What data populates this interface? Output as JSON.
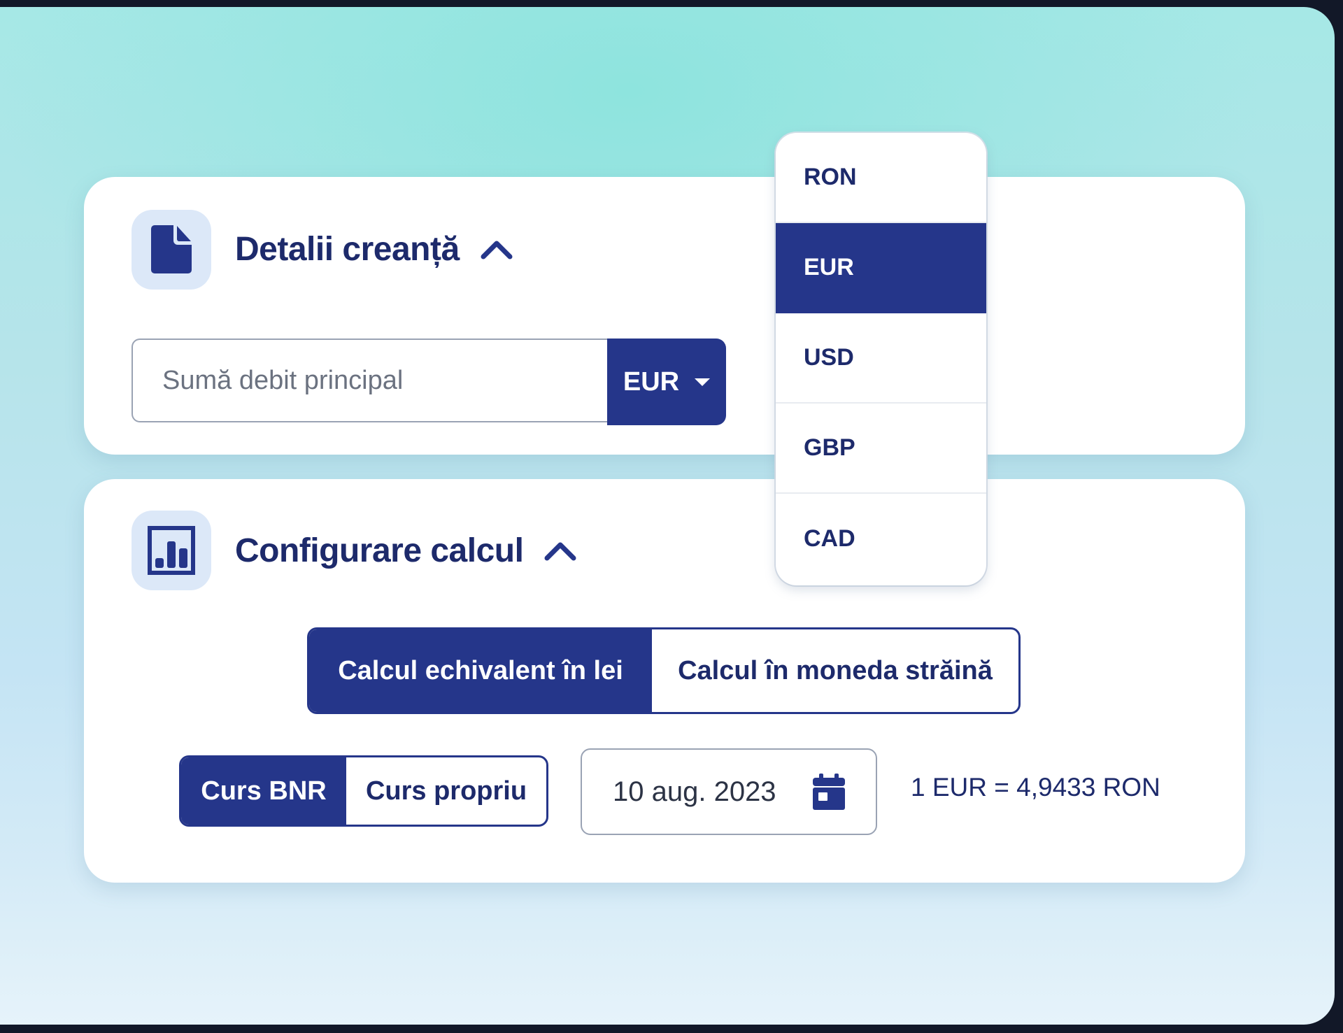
{
  "section_debt": {
    "title": "Detalii creanță",
    "icon": "document-icon",
    "amount_input": {
      "value": "",
      "placeholder": "Sumă debit principal"
    },
    "currency_select": {
      "selected": "EUR"
    }
  },
  "currency_dropdown": {
    "options": [
      {
        "label": "RON",
        "selected": false
      },
      {
        "label": "EUR",
        "selected": true
      },
      {
        "label": "USD",
        "selected": false
      },
      {
        "label": "GBP",
        "selected": false
      },
      {
        "label": "CAD",
        "selected": false
      }
    ]
  },
  "section_config": {
    "title": "Configurare calcul",
    "icon": "bar-chart-icon",
    "calc_mode": {
      "options": [
        "Calcul echivalent în lei",
        "Calcul în moneda străină"
      ],
      "selected": "Calcul echivalent în lei"
    },
    "rate_source": {
      "options": [
        "Curs BNR",
        "Curs propriu"
      ],
      "selected": "Curs BNR"
    },
    "date": "10 aug. 2023",
    "rate_text": "1 EUR = 4,9433 RON"
  },
  "colors": {
    "primary": "#25368a",
    "title_text": "#1d2a6b",
    "icon_bg": "#dce8f8",
    "frame": "#121828"
  }
}
